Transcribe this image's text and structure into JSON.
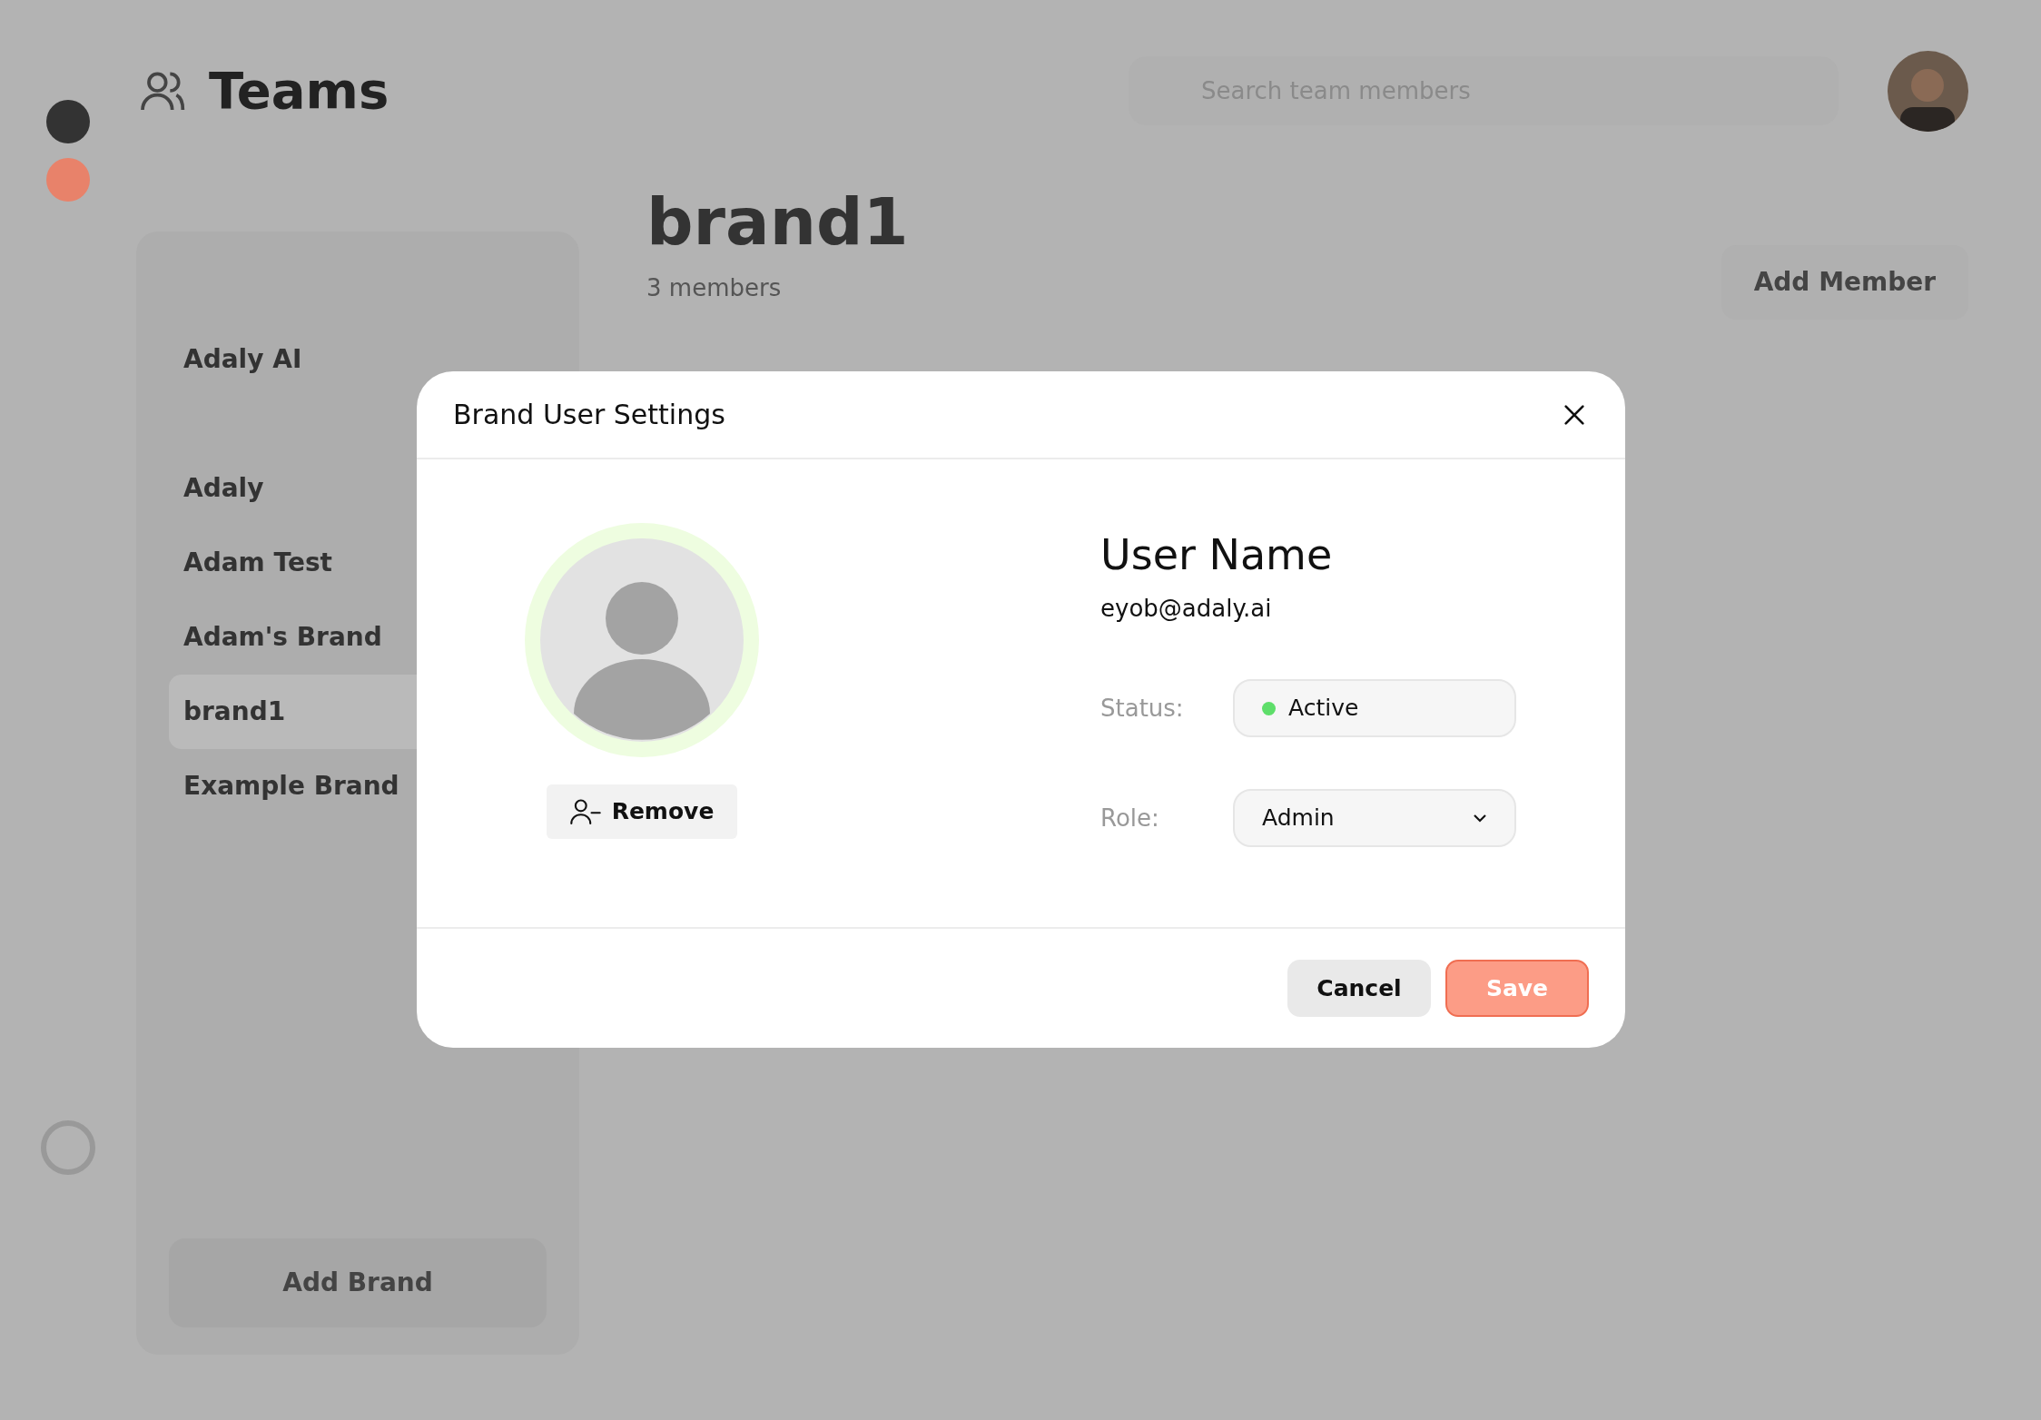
{
  "background": {
    "page_title": "Teams",
    "search": {
      "placeholder": "Search team members"
    },
    "brand_title": "brand1",
    "members_count": "3 members",
    "add_member": "Add Member",
    "sidebar": {
      "items": [
        {
          "name": "Adaly AI",
          "selected": false
        },
        {
          "name": "Adaly",
          "selected": false
        },
        {
          "name": "Adam Test",
          "selected": false
        },
        {
          "name": "Adam's Brand",
          "selected": false
        },
        {
          "name": "brand1",
          "selected": true
        },
        {
          "name": "Example Brand",
          "selected": false
        }
      ],
      "add_brand": "Add Brand"
    }
  },
  "modal": {
    "title": "Brand User Settings",
    "remove": "Remove",
    "user_name": "User Name",
    "email": "eyob@adaly.ai",
    "fields": [
      {
        "kind": "status",
        "label": "Status:",
        "value": "Active",
        "color": "#5ede6a"
      },
      {
        "kind": "select",
        "label": "Role:",
        "value": "Admin"
      }
    ],
    "buttons": [
      {
        "kind": "secondary",
        "label": "Cancel"
      },
      {
        "kind": "primary",
        "label": "Save"
      }
    ]
  }
}
